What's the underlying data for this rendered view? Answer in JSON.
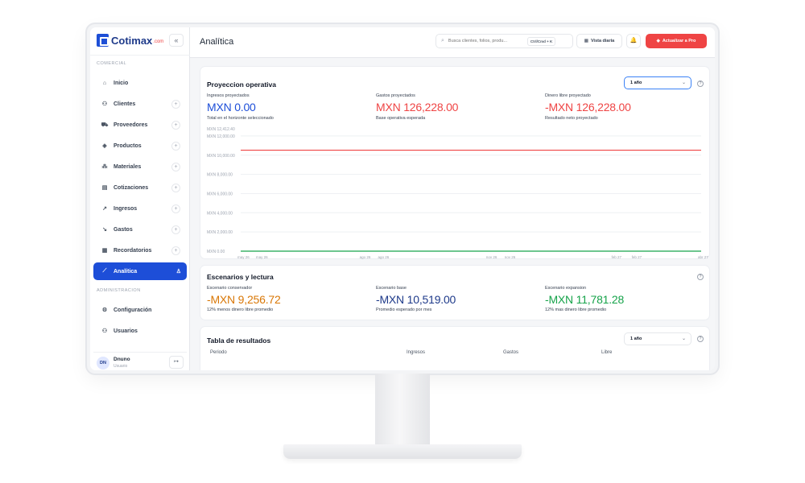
{
  "app": {
    "brand_name": "Cotimax",
    "brand_suffix": ".com",
    "collapse_glyph": "«"
  },
  "sidebar": {
    "section_comercial": "COMERCIAL",
    "section_admin": "ADMINISTRACION",
    "items": [
      {
        "label": "Inicio",
        "icon": "home-icon",
        "glyph": "⌂",
        "plus": false
      },
      {
        "label": "Clientes",
        "icon": "users-icon",
        "glyph": "⚇",
        "plus": true
      },
      {
        "label": "Proveedores",
        "icon": "truck-icon",
        "glyph": "⛟",
        "plus": true
      },
      {
        "label": "Productos",
        "icon": "box-icon",
        "glyph": "◈",
        "plus": true
      },
      {
        "label": "Materiales",
        "icon": "shapes-icon",
        "glyph": "⁂",
        "plus": true
      },
      {
        "label": "Cotizaciones",
        "icon": "document-icon",
        "glyph": "▤",
        "plus": true
      },
      {
        "label": "Ingresos",
        "icon": "trend-up-icon",
        "glyph": "↗",
        "plus": true
      },
      {
        "label": "Gastos",
        "icon": "trend-down-icon",
        "glyph": "↘",
        "plus": true
      },
      {
        "label": "Recordatorios",
        "icon": "calendar-icon",
        "glyph": "▦",
        "plus": true
      },
      {
        "label": "Analítica",
        "icon": "chart-icon",
        "glyph": "⟋",
        "plus": false,
        "active": true,
        "trail_glyph": "♙"
      }
    ],
    "admin_items": [
      {
        "label": "Configuración",
        "icon": "gear-icon",
        "glyph": "⚙"
      },
      {
        "label": "Usuarios",
        "icon": "users-icon",
        "glyph": "⚇"
      }
    ],
    "plus_glyph": "+",
    "user": {
      "initials": "DN",
      "name": "Dnuno",
      "role": "Usuario",
      "logout_glyph": "↦"
    }
  },
  "topbar": {
    "title": "Analítica",
    "search_placeholder": "Busca clientes, folios, produ...",
    "search_shortcut": "Ctrl/Cmd + K",
    "vista_label": "Vista diaria",
    "pro_label": "Actualizar a Pro",
    "glyphs": {
      "search": "⌕",
      "vista": "▦",
      "bell": "♫",
      "pro": "♥"
    }
  },
  "proyeccion": {
    "title": "Proyeccion operativa",
    "range_value": "1 año",
    "chevron": "⌄",
    "help": "?",
    "metrics": [
      {
        "label": "Ingresos proyectados",
        "value": "MXN 0.00",
        "sub": "Total en el horizonte seleccionado",
        "color": "#1d4ed8"
      },
      {
        "label": "Gastos proyectados",
        "value": "MXN 126,228.00",
        "sub": "Base operativa esperada",
        "color": "#ef4444"
      },
      {
        "label": "Dinero libre proyectado",
        "value": "-MXN 126,228.00",
        "sub": "Resultado neto proyectado",
        "color": "#ef4444"
      }
    ]
  },
  "chart_data": {
    "type": "line",
    "y_ticks": [
      "MXN 0.00",
      "MXN 2,000.00",
      "MXN 4,000.00",
      "MXN 6,000.00",
      "MXN 8,000.00",
      "MXN 10,000.00",
      "MXN 12,000.00",
      "MXN 12,412.40"
    ],
    "y_tick_values": [
      0,
      2000,
      4000,
      6000,
      8000,
      10000,
      12000,
      12412.4
    ],
    "ylim": [
      0,
      12412.4
    ],
    "x_ticks": [
      "may 26",
      "may 26",
      "ago 26",
      "ago 26",
      "nov 26",
      "nov 26",
      "feb 27",
      "feb 27",
      "abr 27"
    ],
    "x_tick_positions": [
      0,
      0.04,
      0.265,
      0.305,
      0.54,
      0.58,
      0.812,
      0.856,
      1.0
    ],
    "grid": true,
    "series": [
      {
        "values_from": 0,
        "values_to": 1,
        "y": 10519,
        "color": "#ef4444"
      },
      {
        "values_from": 0,
        "values_to": 1,
        "y": 0,
        "color": "#16a34a"
      }
    ]
  },
  "escenarios": {
    "title": "Escenarios y lectura",
    "help": "?",
    "items": [
      {
        "label": "Escenario conservador",
        "value": "-MXN 9,256.72",
        "sub": "12% menos dinero libre promedio",
        "color": "#d97706"
      },
      {
        "label": "Escenario base",
        "value": "-MXN 10,519.00",
        "sub": "Promedio esperado por mes",
        "color": "#1e3a8a"
      },
      {
        "label": "Escenario expansion",
        "value": "-MXN 11,781.28",
        "sub": "12% mas dinero libre promedio",
        "color": "#16a34a"
      }
    ]
  },
  "tabla": {
    "title": "Tabla de resultados",
    "range_value": "1 año",
    "chevron": "⌄",
    "help": "?",
    "columns": [
      "Periodo",
      "Ingresos",
      "Gastos",
      "Libre"
    ]
  }
}
